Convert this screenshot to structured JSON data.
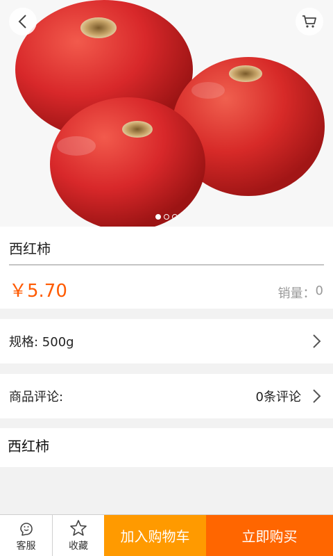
{
  "product": {
    "name": "西红柿",
    "price": "￥5.70",
    "sales_label": "销量：",
    "sales_value": "0",
    "description": "西红柿"
  },
  "carousel": {
    "image": "tomatoes-photo",
    "pages": [
      true,
      false,
      false
    ]
  },
  "spec": {
    "label": "规格: 500g"
  },
  "reviews": {
    "label": "商品评论:",
    "count_text": "0条评论"
  },
  "bottom_bar": {
    "service_label": "客服",
    "favorite_label": "收藏",
    "add_to_cart_label": "加入购物车",
    "buy_now_label": "立即购买"
  },
  "colors": {
    "accent": "#ff5a00",
    "add_to_cart": "#ff9a00",
    "buy_now": "#ff6600"
  },
  "icons": [
    "back-icon",
    "cart-icon",
    "chevron-right-icon",
    "service-icon",
    "star-icon"
  ]
}
